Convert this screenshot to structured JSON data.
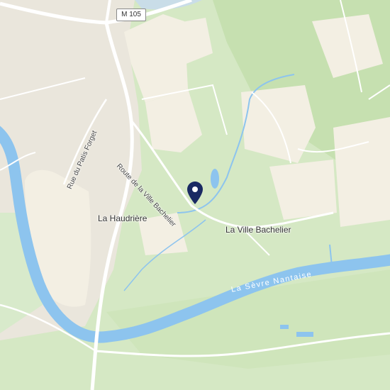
{
  "map": {
    "road_shield": "M 105",
    "labels": {
      "route": "Route de la Ville Bachelier",
      "rue": "Rue du Patis Forget",
      "haudriere": "La Haudrière",
      "ville_bachelier": "La Ville Bachelier",
      "river": "La Sèvre Nantaise"
    },
    "colors": {
      "water": "#8dc4ee",
      "green": "#d5e8c4",
      "green_dark": "#c6e0b0",
      "urban": "#eae6dc",
      "field": "#f3efe3",
      "road": "#ffffff",
      "marker": "#1a2a63"
    },
    "marker_icon": "location-pin-icon"
  }
}
